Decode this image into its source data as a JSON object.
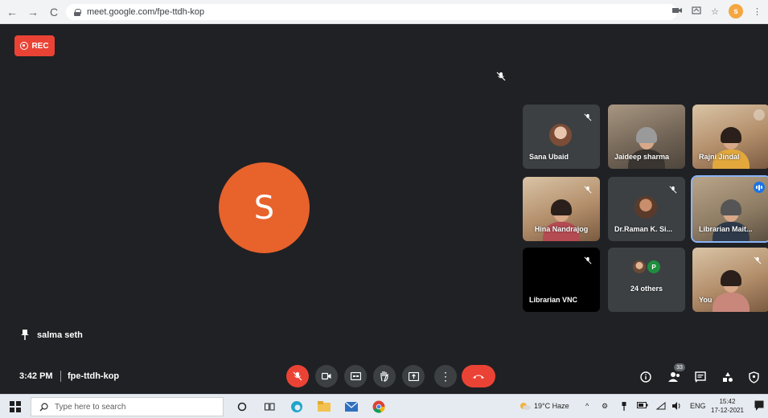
{
  "browser": {
    "url": "meet.google.com/fpe-ttdh-kop",
    "profile_initial": "s"
  },
  "meet": {
    "rec_label": "REC",
    "main_avatar_letter": "S",
    "presenter_name": "salma seth",
    "tiles": [
      {
        "name": "Sana Ubaid",
        "muted": true
      },
      {
        "name": "Jaideep sharma",
        "muted": false
      },
      {
        "name": "Rajni Jindal",
        "muted": false
      },
      {
        "name": "Hina Nandrajog",
        "muted": true
      },
      {
        "name": "Dr.Raman K. Si...",
        "muted": true
      },
      {
        "name": "Librarian Mait...",
        "muted": false
      },
      {
        "name": "Librarian VNC",
        "muted": true
      },
      {
        "name": "24 others",
        "muted": false,
        "mini_initial": "P"
      },
      {
        "name": "You",
        "muted": true
      }
    ]
  },
  "bottom_bar": {
    "time": "3:42 PM",
    "meeting_code": "fpe-ttdh-kop",
    "participants_count": "33"
  },
  "taskbar": {
    "search_placeholder": "Type here to search",
    "weather": "19°C  Haze",
    "language": "ENG",
    "clock_time": "15:42",
    "clock_date": "17-12-2021"
  },
  "colors": {
    "meet_bg": "#202124",
    "tile_bg": "#3c4043",
    "red": "#ea4335",
    "avatar_orange": "#e8622c",
    "speaking_blue": "#1a73e8"
  }
}
